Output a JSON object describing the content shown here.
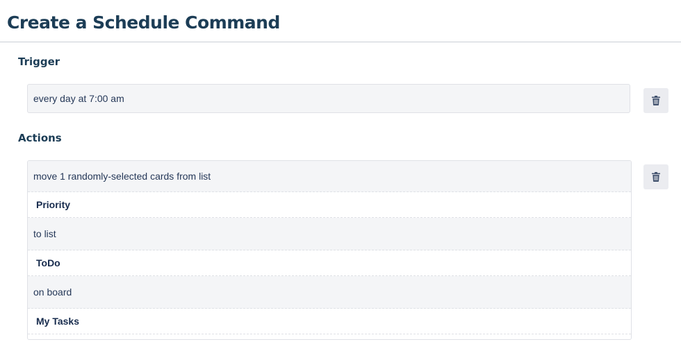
{
  "header": {
    "title": "Create a Schedule Command"
  },
  "trigger": {
    "heading": "Trigger",
    "text": "every day at 7:00 am",
    "delete_icon": "trash-icon"
  },
  "actions": {
    "heading": "Actions",
    "delete_icon": "trash-icon",
    "rows": [
      {
        "kind": "text",
        "value": "move 1 randomly-selected cards from list"
      },
      {
        "kind": "field",
        "value": "Priority"
      },
      {
        "kind": "text",
        "value": "to list"
      },
      {
        "kind": "field",
        "value": "ToDo"
      },
      {
        "kind": "text",
        "value": "on board"
      },
      {
        "kind": "field",
        "value": "My Tasks"
      }
    ]
  },
  "colors": {
    "heading": "#1c3d56",
    "box_background": "#f4f5f7",
    "border": "#dfe1e6",
    "button_background": "#ebecf0",
    "icon": "#42526e"
  }
}
